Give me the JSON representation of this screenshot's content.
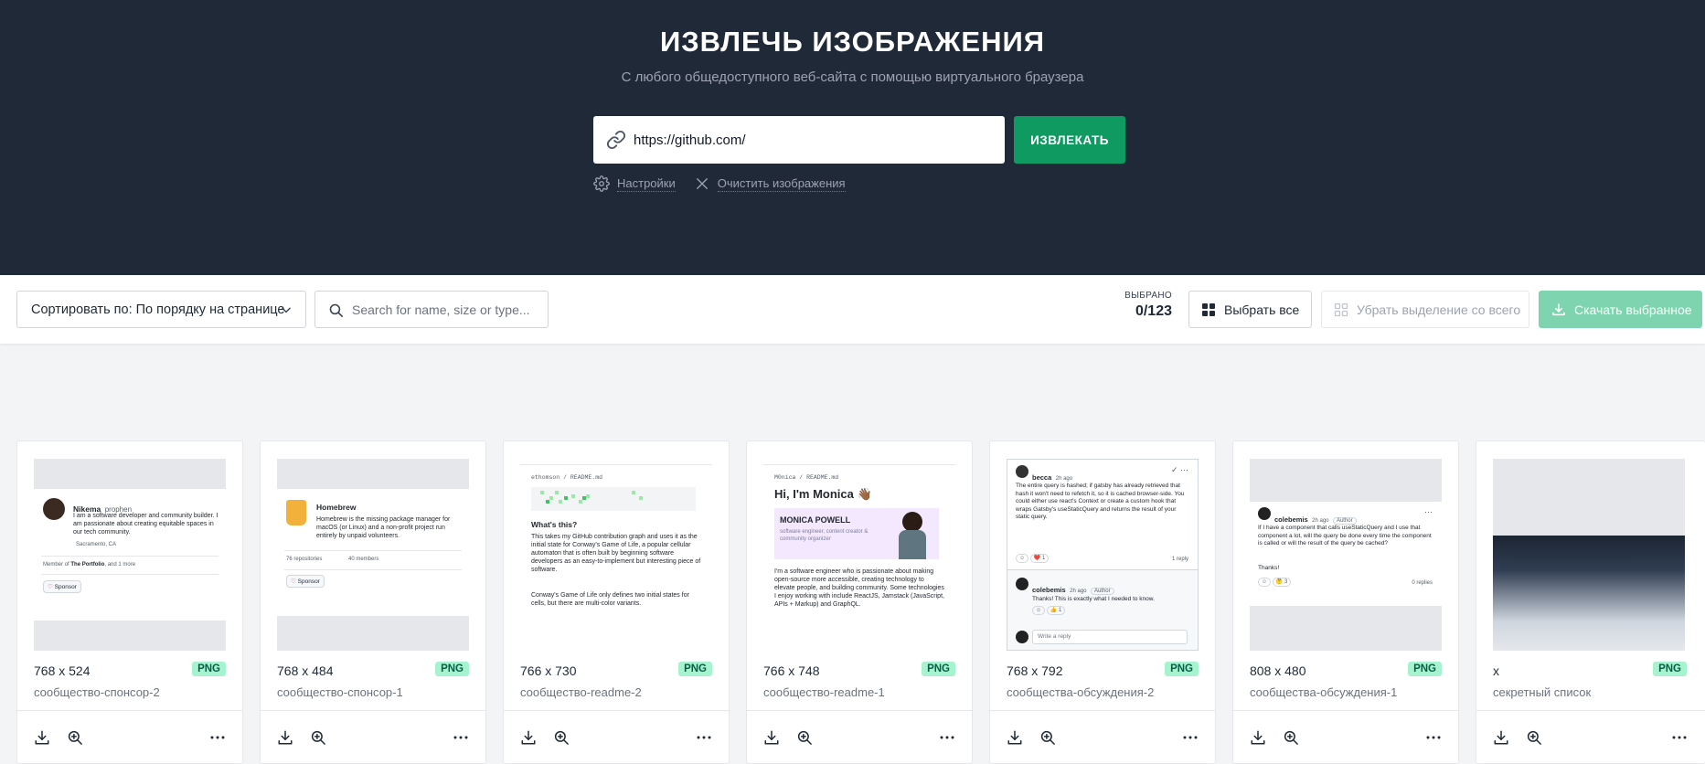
{
  "header": {
    "title": "ИЗВЛЕЧЬ ИЗОБРАЖЕНИЯ",
    "subtitle": "С любого общедоступного веб-сайта с помощью виртуального браузера",
    "url_value": "https://github.com/",
    "extract_label": "ИЗВЛЕКАТЬ",
    "settings_label": "Настройки",
    "clear_label": "Очистить изображения"
  },
  "toolbar": {
    "sort_label": "Сортировать по: По порядку на странице",
    "search_placeholder": "Search for name, size or type...",
    "selected_label": "ВЫБРАНО",
    "selected_count": "0/123",
    "select_all_label": "Выбрать все",
    "deselect_all_label": "Убрать выделение со всего",
    "download_selected_label": "Скачать выбранное"
  },
  "colors": {
    "header_bg": "#202938",
    "accent_green": "#0f9a62",
    "badge_green": "#a7f3d0",
    "download_disabled": "#7dd4ae"
  },
  "icons": {
    "url": "link-icon",
    "settings": "gear-icon",
    "clear": "close-icon",
    "sort": "chevron-down-icon",
    "search": "search-icon",
    "select_all": "grid-icon",
    "deselect": "grid-outline-icon",
    "download": "download-icon",
    "zoom": "zoom-in-icon",
    "more": "more-icon"
  },
  "cards": [
    {
      "dims": "768 x 524",
      "type": "PNG",
      "name": "сообщество-спонсор-2",
      "thumb": {
        "name": "Nikema",
        "handle": "prophen",
        "bio": "I am a software developer and community builder. I am passionate about creating equitable spaces in our tech community.",
        "location": "Sacramento, CA",
        "member_prefix": "Member of",
        "member_org": "The Portfolio",
        "member_suffix": ", and 1 more",
        "sponsor": "Sponsor"
      }
    },
    {
      "dims": "768 x 484",
      "type": "PNG",
      "name": "сообщество-спонсор-1",
      "thumb": {
        "name": "Homebrew",
        "bio": "Homebrew is the missing package manager for macOS (or Linux) and a non-profit project run entirely by unpaid volunteers.",
        "repos": "76 repositories",
        "members": "40 members",
        "sponsor": "Sponsor"
      }
    },
    {
      "dims": "766 x 730",
      "type": "PNG",
      "name": "сообщество-readme-2",
      "thumb": {
        "path": "ethomson / README.md",
        "heading": "What's this?",
        "p1": "This takes my GitHub contribution graph and uses it as the initial state for Conway's Game of Life, a popular cellular automaton that is often built by beginning software developers as an easy-to-implement but interesting piece of software.",
        "p2": "Conway's Game of Life only defines two initial states for cells, but there are multi-color variants."
      }
    },
    {
      "dims": "766 x 748",
      "type": "PNG",
      "name": "сообщество-readme-1",
      "thumb": {
        "path": "M0nica / README.md",
        "heading": "Hi, I'm Monica 👋🏾",
        "banner_title": "MONICA POWELL",
        "banner_sub": "software engineer, content creator & community organizer",
        "p1": "I'm a software engineer who is passionate about making open-source more accessible, creating technology to elevate people, and building community. Some technologies I enjoy working with include ReactJS, Jamstack (JavaScript, APIs + Markup) and GraphQL."
      }
    },
    {
      "dims": "768 x 792",
      "type": "PNG",
      "name": "сообщества-обсуждения-2",
      "thumb": {
        "user": "becca",
        "time": "2h ago",
        "body": "The entire query is hashed; if gatsby has already retrieved that hash it won't need to refetch it, so it is cached browser-side. You could either use react's Context or create a custom hook that wraps Gatsby's useStaticQuery and returns the result of your static query.",
        "reactions": "❤️ 1",
        "replies": "1 reply",
        "reply_user": "colebemis",
        "reply_time": "2h ago",
        "reply_role": "Author",
        "reply_body": "Thanks! This is exactly what I needed to know.",
        "reply_reactions": "👍 1",
        "write_placeholder": "Write a reply"
      }
    },
    {
      "dims": "808 x 480",
      "type": "PNG",
      "name": "сообщества-обсуждения-1",
      "thumb": {
        "user": "colebemis",
        "time": "2h ago",
        "role": "Author",
        "body": "If I have a component that calls useStaticQuery and I use that component a lot, will the query be done every time the component is called or will the result of the query be cached?",
        "thanks": "Thanks!",
        "reactions": "🤔 3",
        "replies": "0 replies"
      }
    },
    {
      "dims": "x",
      "type": "PNG",
      "name": "секретный список",
      "thumb": {}
    }
  ]
}
